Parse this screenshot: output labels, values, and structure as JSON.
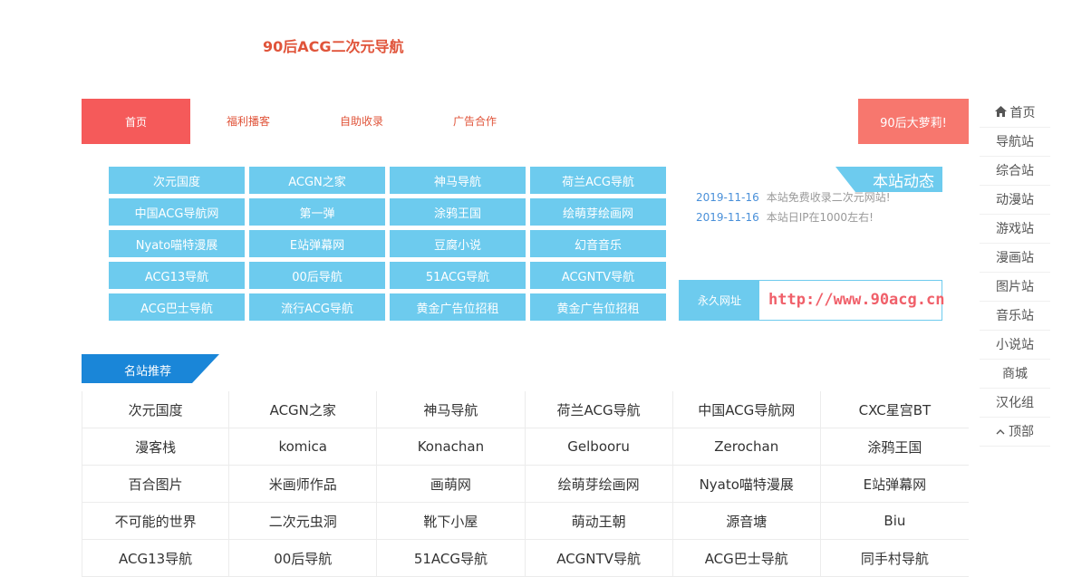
{
  "header": {
    "site_title": "90后ACG二次元导航"
  },
  "nav": {
    "home": "首页",
    "links": [
      "福利播客",
      "自助收录",
      "广告合作"
    ],
    "right_button": "90后大萝莉!"
  },
  "tiles": [
    "次元国度",
    "ACGN之家",
    "神马导航",
    "荷兰ACG导航",
    "中国ACG导航网",
    "第一弹",
    "涂鸦王国",
    "绘萌芽绘画网",
    "Nyato喵特漫展",
    "E站弹幕网",
    "豆腐小说",
    "幻音音乐",
    "ACG13导航",
    "00后导航",
    "51ACG导航",
    "ACGNTV导航",
    "ACG巴士导航",
    "流行ACG导航",
    "黄金广告位招租",
    "黄金广告位招租"
  ],
  "news": {
    "title": "本站动态",
    "items": [
      {
        "date": "2019-11-16",
        "text": "本站免费收录二次元网站!"
      },
      {
        "date": "2019-11-16",
        "text": "本站日IP在1000左右!"
      }
    ]
  },
  "permanent": {
    "label": "永久网址",
    "url": "http://www.90acg.cn"
  },
  "recommended": {
    "title": "名站推荐",
    "items": [
      "次元国度",
      "ACGN之家",
      "神马导航",
      "荷兰ACG导航",
      "中国ACG导航网",
      "CXC星宫BT",
      "漫客栈",
      "komica",
      "Konachan",
      "Gelbooru",
      "Zerochan",
      "涂鸦王国",
      "百合图片",
      "米画师作品",
      "画萌网",
      "绘萌芽绘画网",
      "Nyato喵特漫展",
      "E站弹幕网",
      "不可能的世界",
      "二次元虫洞",
      "靴下小屋",
      "萌动王朝",
      "源音塘",
      "Biu",
      "ACG13导航",
      "00后导航",
      "51ACG导航",
      "ACGNTV导航",
      "ACG巴士导航",
      "同手村导航"
    ]
  },
  "sidebar": {
    "items": [
      "首页",
      "导航站",
      "综合站",
      "动漫站",
      "游戏站",
      "漫画站",
      "图片站",
      "音乐站",
      "小说站",
      "商城",
      "汉化组",
      "顶部"
    ],
    "home_icon": "home-icon",
    "top_icon": "chevron-up-icon"
  }
}
